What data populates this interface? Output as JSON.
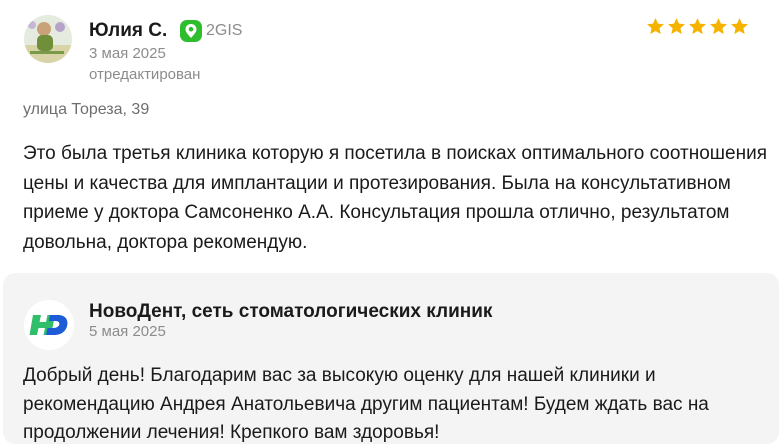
{
  "review": {
    "author": "Юлия С.",
    "source": "2GIS",
    "date": "3 мая 2025",
    "edited": "отредактирован",
    "rating": 5,
    "address": "улица Тореза, 39",
    "text": "Это была третья клиника которую я посетила в поисках оптимального соотношения цены и качества для имплантации и протезирования. Была на консультативном приеме у доктора Самсоненко А.А. Консультация прошла отлично, результатом довольна, доктора рекомендую."
  },
  "reply": {
    "company": "НовоДент, сеть стоматологических клиник",
    "date": "5 мая 2025",
    "text": "Добрый день! Благодарим вас за высокую оценку для нашей клиники и рекомендацию Андрея Анатольевича другим пациентам! Будем ждать вас на продолжении лечения! Крепкого вам здоровья!"
  },
  "colors": {
    "star": "#f5b300",
    "source_badge": "#2dbd2d",
    "logo_blue": "#1e5bd6",
    "logo_green": "#2fbf6a",
    "reply_bg": "#f4f4f4"
  },
  "icons": {
    "source": "2gis-pin-icon",
    "star": "star-icon"
  }
}
